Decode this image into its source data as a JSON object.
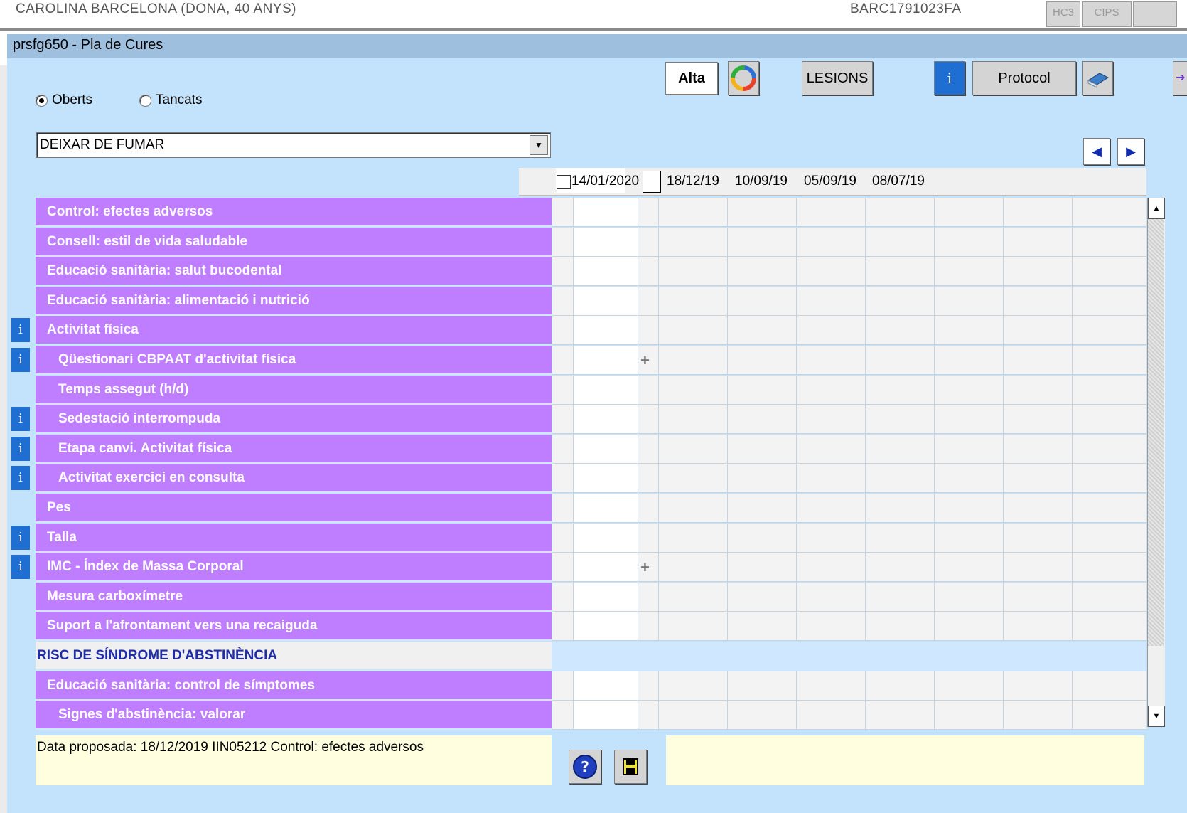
{
  "patient_bar": {
    "name": "CAROLINA BARCELONA   (DONA, 40 ANYS)",
    "id": "BARC1791023FA",
    "buttons": [
      "HC3",
      "CIPS"
    ]
  },
  "window": {
    "title": "prsfg650 - Pla de Cures"
  },
  "filters": {
    "open_label": "Oberts",
    "closed_label": "Tancats",
    "selected": "Oberts"
  },
  "dropdown": {
    "selected": "DEIXAR DE FUMAR"
  },
  "toolbar": {
    "alta_label": "Alta",
    "lesions_label": "LESIONS",
    "info_glyph": "i",
    "protocol_label": "Protocol",
    "prev_icon": "triangle-left-icon",
    "next_icon": "triangle-right-icon"
  },
  "grid": {
    "dates": [
      "14/01/2020",
      "18/12/19",
      "10/09/19",
      "05/09/19",
      "08/07/19",
      "",
      "",
      ""
    ],
    "rows": [
      {
        "label": "Control: efectes adversos",
        "info": false,
        "indent": false,
        "plus": false,
        "section": false
      },
      {
        "label": "Consell: estil de vida saludable",
        "info": false,
        "indent": false,
        "plus": false,
        "section": false
      },
      {
        "label": "Educació sanitària: salut bucodental",
        "info": false,
        "indent": false,
        "plus": false,
        "section": false
      },
      {
        "label": "Educació sanitària: alimentació i nutrició",
        "info": false,
        "indent": false,
        "plus": false,
        "section": false
      },
      {
        "label": "Activitat física",
        "info": true,
        "indent": false,
        "plus": false,
        "section": false
      },
      {
        "label": "Qüestionari CBPAAT d'activitat física",
        "info": true,
        "indent": true,
        "plus": true,
        "section": false
      },
      {
        "label": "Temps assegut (h/d)",
        "info": false,
        "indent": true,
        "plus": false,
        "section": false
      },
      {
        "label": "Sedestació interrompuda",
        "info": true,
        "indent": true,
        "plus": false,
        "section": false
      },
      {
        "label": "Etapa canvi. Activitat física",
        "info": true,
        "indent": true,
        "plus": false,
        "section": false
      },
      {
        "label": "Activitat exercici en consulta",
        "info": true,
        "indent": true,
        "plus": false,
        "section": false
      },
      {
        "label": "Pes",
        "info": false,
        "indent": false,
        "plus": false,
        "section": false
      },
      {
        "label": "Talla",
        "info": true,
        "indent": false,
        "plus": false,
        "section": false
      },
      {
        "label": "IMC - Índex de Massa Corporal",
        "info": true,
        "indent": false,
        "plus": true,
        "section": false
      },
      {
        "label": "Mesura carboxímetre",
        "info": false,
        "indent": false,
        "plus": false,
        "section": false
      },
      {
        "label": "Suport a l'afrontament vers una recaiguda",
        "info": false,
        "indent": false,
        "plus": false,
        "section": false
      },
      {
        "label": "RISC DE SÍNDROME D'ABSTINÈNCIA",
        "info": false,
        "indent": false,
        "plus": false,
        "section": true
      },
      {
        "label": "Educació sanitària: control de símptomes",
        "info": false,
        "indent": false,
        "plus": false,
        "section": false
      },
      {
        "label": "Signes d'abstinència: valorar",
        "info": false,
        "indent": true,
        "plus": false,
        "section": false
      }
    ]
  },
  "footer": {
    "info_text": "Data proposada: 18/12/2019 IIN05212 Control: efectes adversos",
    "help_icon": "help-icon",
    "save_icon": "floppy-disk-icon"
  },
  "colors": {
    "panel": "#c3e3fd",
    "title_bar": "#9fbfdf",
    "row_purple": "#bf7dff",
    "section_text": "#1f2ea8",
    "info_blue": "#1f6fd3",
    "note_yellow": "#ffffe0"
  }
}
